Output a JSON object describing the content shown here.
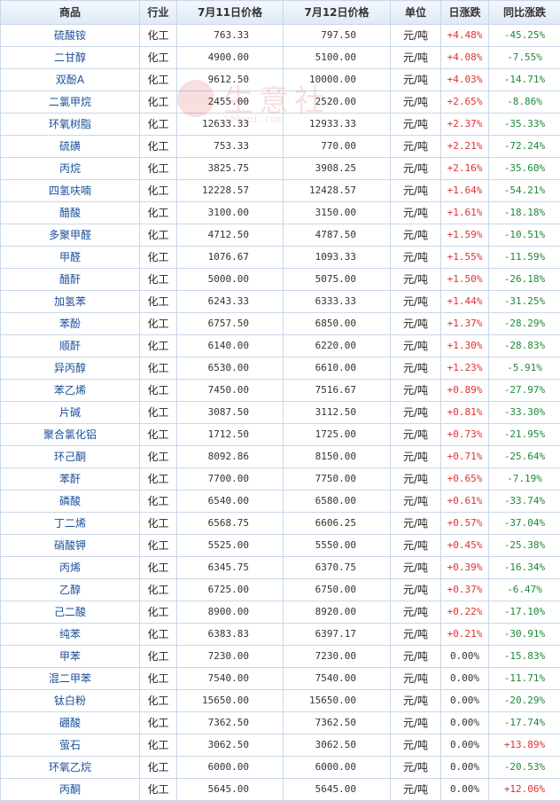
{
  "headers": [
    "商品",
    "行业",
    "7月11日价格",
    "7月12日价格",
    "单位",
    "日涨跌",
    "同比涨跌"
  ],
  "watermark": {
    "text": "生意社",
    "sub": "100ppi.com"
  },
  "rows": [
    {
      "name": "硫酸铵",
      "industry": "化工",
      "p1": "763.33",
      "p2": "797.50",
      "unit": "元/吨",
      "day": "+4.48%",
      "yoy": "-45.25%"
    },
    {
      "name": "二甘醇",
      "industry": "化工",
      "p1": "4900.00",
      "p2": "5100.00",
      "unit": "元/吨",
      "day": "+4.08%",
      "yoy": "-7.55%"
    },
    {
      "name": "双酚A",
      "industry": "化工",
      "p1": "9612.50",
      "p2": "10000.00",
      "unit": "元/吨",
      "day": "+4.03%",
      "yoy": "-14.71%"
    },
    {
      "name": "二氯甲烷",
      "industry": "化工",
      "p1": "2455.00",
      "p2": "2520.00",
      "unit": "元/吨",
      "day": "+2.65%",
      "yoy": "-8.86%"
    },
    {
      "name": "环氧树脂",
      "industry": "化工",
      "p1": "12633.33",
      "p2": "12933.33",
      "unit": "元/吨",
      "day": "+2.37%",
      "yoy": "-35.33%"
    },
    {
      "name": "硫磺",
      "industry": "化工",
      "p1": "753.33",
      "p2": "770.00",
      "unit": "元/吨",
      "day": "+2.21%",
      "yoy": "-72.24%"
    },
    {
      "name": "丙烷",
      "industry": "化工",
      "p1": "3825.75",
      "p2": "3908.25",
      "unit": "元/吨",
      "day": "+2.16%",
      "yoy": "-35.60%"
    },
    {
      "name": "四氢呋喃",
      "industry": "化工",
      "p1": "12228.57",
      "p2": "12428.57",
      "unit": "元/吨",
      "day": "+1.64%",
      "yoy": "-54.21%"
    },
    {
      "name": "醋酸",
      "industry": "化工",
      "p1": "3100.00",
      "p2": "3150.00",
      "unit": "元/吨",
      "day": "+1.61%",
      "yoy": "-18.18%"
    },
    {
      "name": "多聚甲醛",
      "industry": "化工",
      "p1": "4712.50",
      "p2": "4787.50",
      "unit": "元/吨",
      "day": "+1.59%",
      "yoy": "-10.51%"
    },
    {
      "name": "甲醛",
      "industry": "化工",
      "p1": "1076.67",
      "p2": "1093.33",
      "unit": "元/吨",
      "day": "+1.55%",
      "yoy": "-11.59%"
    },
    {
      "name": "醋酐",
      "industry": "化工",
      "p1": "5000.00",
      "p2": "5075.00",
      "unit": "元/吨",
      "day": "+1.50%",
      "yoy": "-26.18%"
    },
    {
      "name": "加氢苯",
      "industry": "化工",
      "p1": "6243.33",
      "p2": "6333.33",
      "unit": "元/吨",
      "day": "+1.44%",
      "yoy": "-31.25%"
    },
    {
      "name": "苯酚",
      "industry": "化工",
      "p1": "6757.50",
      "p2": "6850.00",
      "unit": "元/吨",
      "day": "+1.37%",
      "yoy": "-28.29%"
    },
    {
      "name": "顺酐",
      "industry": "化工",
      "p1": "6140.00",
      "p2": "6220.00",
      "unit": "元/吨",
      "day": "+1.30%",
      "yoy": "-28.83%"
    },
    {
      "name": "异丙醇",
      "industry": "化工",
      "p1": "6530.00",
      "p2": "6610.00",
      "unit": "元/吨",
      "day": "+1.23%",
      "yoy": "-5.91%"
    },
    {
      "name": "苯乙烯",
      "industry": "化工",
      "p1": "7450.00",
      "p2": "7516.67",
      "unit": "元/吨",
      "day": "+0.89%",
      "yoy": "-27.97%"
    },
    {
      "name": "片碱",
      "industry": "化工",
      "p1": "3087.50",
      "p2": "3112.50",
      "unit": "元/吨",
      "day": "+0.81%",
      "yoy": "-33.30%"
    },
    {
      "name": "聚合氯化铝",
      "industry": "化工",
      "p1": "1712.50",
      "p2": "1725.00",
      "unit": "元/吨",
      "day": "+0.73%",
      "yoy": "-21.95%"
    },
    {
      "name": "环己酮",
      "industry": "化工",
      "p1": "8092.86",
      "p2": "8150.00",
      "unit": "元/吨",
      "day": "+0.71%",
      "yoy": "-25.64%"
    },
    {
      "name": "苯酐",
      "industry": "化工",
      "p1": "7700.00",
      "p2": "7750.00",
      "unit": "元/吨",
      "day": "+0.65%",
      "yoy": "-7.19%"
    },
    {
      "name": "磷酸",
      "industry": "化工",
      "p1": "6540.00",
      "p2": "6580.00",
      "unit": "元/吨",
      "day": "+0.61%",
      "yoy": "-33.74%"
    },
    {
      "name": "丁二烯",
      "industry": "化工",
      "p1": "6568.75",
      "p2": "6606.25",
      "unit": "元/吨",
      "day": "+0.57%",
      "yoy": "-37.04%"
    },
    {
      "name": "硝酸钾",
      "industry": "化工",
      "p1": "5525.00",
      "p2": "5550.00",
      "unit": "元/吨",
      "day": "+0.45%",
      "yoy": "-25.38%"
    },
    {
      "name": "丙烯",
      "industry": "化工",
      "p1": "6345.75",
      "p2": "6370.75",
      "unit": "元/吨",
      "day": "+0.39%",
      "yoy": "-16.34%"
    },
    {
      "name": "乙醇",
      "industry": "化工",
      "p1": "6725.00",
      "p2": "6750.00",
      "unit": "元/吨",
      "day": "+0.37%",
      "yoy": "-6.47%"
    },
    {
      "name": "己二酸",
      "industry": "化工",
      "p1": "8900.00",
      "p2": "8920.00",
      "unit": "元/吨",
      "day": "+0.22%",
      "yoy": "-17.10%"
    },
    {
      "name": "纯苯",
      "industry": "化工",
      "p1": "6383.83",
      "p2": "6397.17",
      "unit": "元/吨",
      "day": "+0.21%",
      "yoy": "-30.91%"
    },
    {
      "name": "甲苯",
      "industry": "化工",
      "p1": "7230.00",
      "p2": "7230.00",
      "unit": "元/吨",
      "day": "0.00%",
      "yoy": "-15.83%"
    },
    {
      "name": "混二甲苯",
      "industry": "化工",
      "p1": "7540.00",
      "p2": "7540.00",
      "unit": "元/吨",
      "day": "0.00%",
      "yoy": "-11.71%"
    },
    {
      "name": "钛白粉",
      "industry": "化工",
      "p1": "15650.00",
      "p2": "15650.00",
      "unit": "元/吨",
      "day": "0.00%",
      "yoy": "-20.29%"
    },
    {
      "name": "硼酸",
      "industry": "化工",
      "p1": "7362.50",
      "p2": "7362.50",
      "unit": "元/吨",
      "day": "0.00%",
      "yoy": "-17.74%"
    },
    {
      "name": "萤石",
      "industry": "化工",
      "p1": "3062.50",
      "p2": "3062.50",
      "unit": "元/吨",
      "day": "0.00%",
      "yoy": "+13.89%"
    },
    {
      "name": "环氧乙烷",
      "industry": "化工",
      "p1": "6000.00",
      "p2": "6000.00",
      "unit": "元/吨",
      "day": "0.00%",
      "yoy": "-20.53%"
    },
    {
      "name": "丙酮",
      "industry": "化工",
      "p1": "5645.00",
      "p2": "5645.00",
      "unit": "元/吨",
      "day": "0.00%",
      "yoy": "+12.06%"
    }
  ]
}
